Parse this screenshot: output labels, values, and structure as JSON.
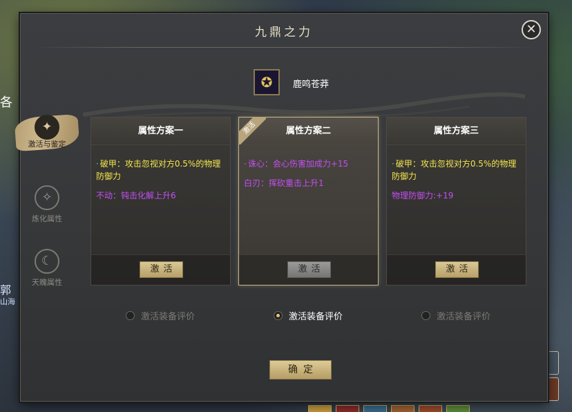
{
  "window": {
    "title": "九鼎之力",
    "close_symbol": "✕"
  },
  "sidebar": {
    "tabs": [
      {
        "label": "激活与鉴定",
        "icon": "scroll-seal-icon",
        "active": true
      },
      {
        "label": "炼化属性",
        "icon": "spark-swirl-icon",
        "active": false
      },
      {
        "label": "天魄属性",
        "icon": "moon-spirit-icon",
        "active": false
      }
    ]
  },
  "equipment": {
    "name": "鹿鸣苍莽",
    "icon": "armor-item-icon"
  },
  "schemes": [
    {
      "title": "属性方案一",
      "active": false,
      "ribbon": "",
      "lines": [
        {
          "text": "破甲：攻击忽视对方0.5%的物理防御力",
          "color": "yellow",
          "bullet": "·"
        },
        {
          "text": "不动：钝击化解上升6",
          "color": "purple",
          "bullet": ""
        }
      ],
      "button_label": "激活",
      "button_disabled": false
    },
    {
      "title": "属性方案二",
      "active": true,
      "ribbon": "激活",
      "lines": [
        {
          "text": "诛心：会心伤害加成力+15",
          "color": "purple",
          "bullet": "·"
        },
        {
          "text": "白刃：挥砍重击上升1",
          "color": "purple",
          "bullet": ""
        }
      ],
      "button_label": "激活",
      "button_disabled": true
    },
    {
      "title": "属性方案三",
      "active": false,
      "ribbon": "",
      "lines": [
        {
          "text": "破甲：攻击忽视对方0.5%的物理防御力",
          "color": "yellow",
          "bullet": "·"
        },
        {
          "text": "物理防御力:+19",
          "color": "purple",
          "bullet": ""
        }
      ],
      "button_label": "激活",
      "button_disabled": false
    }
  ],
  "radio_options": [
    {
      "label": "激活装备评价",
      "checked": false
    },
    {
      "label": "激活装备评价",
      "checked": true
    },
    {
      "label": "激活装备评价",
      "checked": false
    }
  ],
  "confirm_label": "确定",
  "background": {
    "left_text_1": "各",
    "left_text_2": "郭",
    "left_text_3": "山海"
  },
  "colors": {
    "accent_gold": "#c7b58c",
    "attr_yellow": "#f4e64c",
    "attr_purple": "#c44ff2"
  }
}
